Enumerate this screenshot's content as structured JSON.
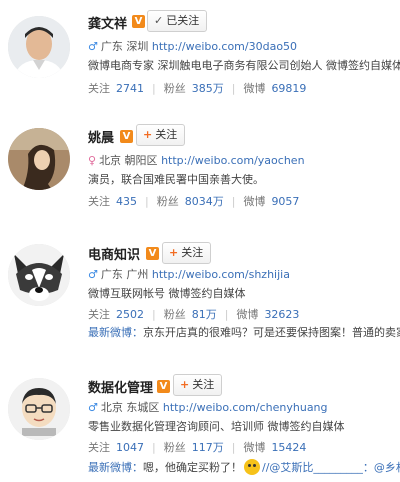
{
  "users": [
    {
      "name": "龚文祥",
      "verified_mark": "V",
      "follow_state": "followed",
      "follow_label": "已关注",
      "gender": "male",
      "gender_symbol": "♂",
      "location": "广东 深圳",
      "url": "http://weibo.com/30dao50",
      "bio": "微博电商专家 深圳触电电子商务有限公司创始人 微博签约自媒体",
      "stats": {
        "follow_label": "关注",
        "follow_count": "2741",
        "fans_label": "粉丝",
        "fans_count": "385万",
        "weibo_label": "微博",
        "weibo_count": "69819"
      }
    },
    {
      "name": "姚晨",
      "verified_mark": "V",
      "follow_state": "not_followed",
      "follow_label": "关注",
      "gender": "female",
      "gender_symbol": "♀",
      "location": "北京 朝阳区",
      "url": "http://weibo.com/yaochen",
      "bio": "演员，联合国难民署中国亲善大使。",
      "stats": {
        "follow_label": "关注",
        "follow_count": "435",
        "fans_label": "粉丝",
        "fans_count": "8034万",
        "weibo_label": "微博",
        "weibo_count": "9057"
      }
    },
    {
      "name": "电商知识",
      "verified_mark": "V",
      "follow_state": "not_followed",
      "follow_label": "关注",
      "gender": "male",
      "gender_symbol": "♂",
      "location": "广东 广州",
      "url": "http://weibo.com/shzhijia",
      "bio": "微博互联网帐号 微博签约自媒体",
      "stats": {
        "follow_label": "关注",
        "follow_count": "2502",
        "fans_label": "粉丝",
        "fans_count": "81万",
        "weibo_label": "微博",
        "weibo_count": "32623"
      },
      "latest": {
        "label": "最新微博：",
        "text": "京东开店真的很难吗？可是还要保持图案！普通的卖家可以这"
      }
    },
    {
      "name": "数据化管理",
      "verified_mark": "V",
      "follow_state": "not_followed",
      "follow_label": "关注",
      "gender": "male",
      "gender_symbol": "♂",
      "location": "北京 东城区",
      "url": "http://weibo.com/chenyhuang",
      "bio": "零售业数据化管理咨询顾问、培训师 微博签约自媒体",
      "stats": {
        "follow_label": "关注",
        "follow_count": "1047",
        "fans_label": "粉丝",
        "fans_count": "117万",
        "weibo_label": "微博",
        "weibo_count": "15424"
      },
      "latest": {
        "label": "最新微博：",
        "text": "嗯，他确定买粉了！",
        "mention1": "//@艾斯比_________：",
        "mention2": "@乡村教师"
      }
    }
  ],
  "icons": {
    "plus": "+",
    "check": "✓"
  }
}
